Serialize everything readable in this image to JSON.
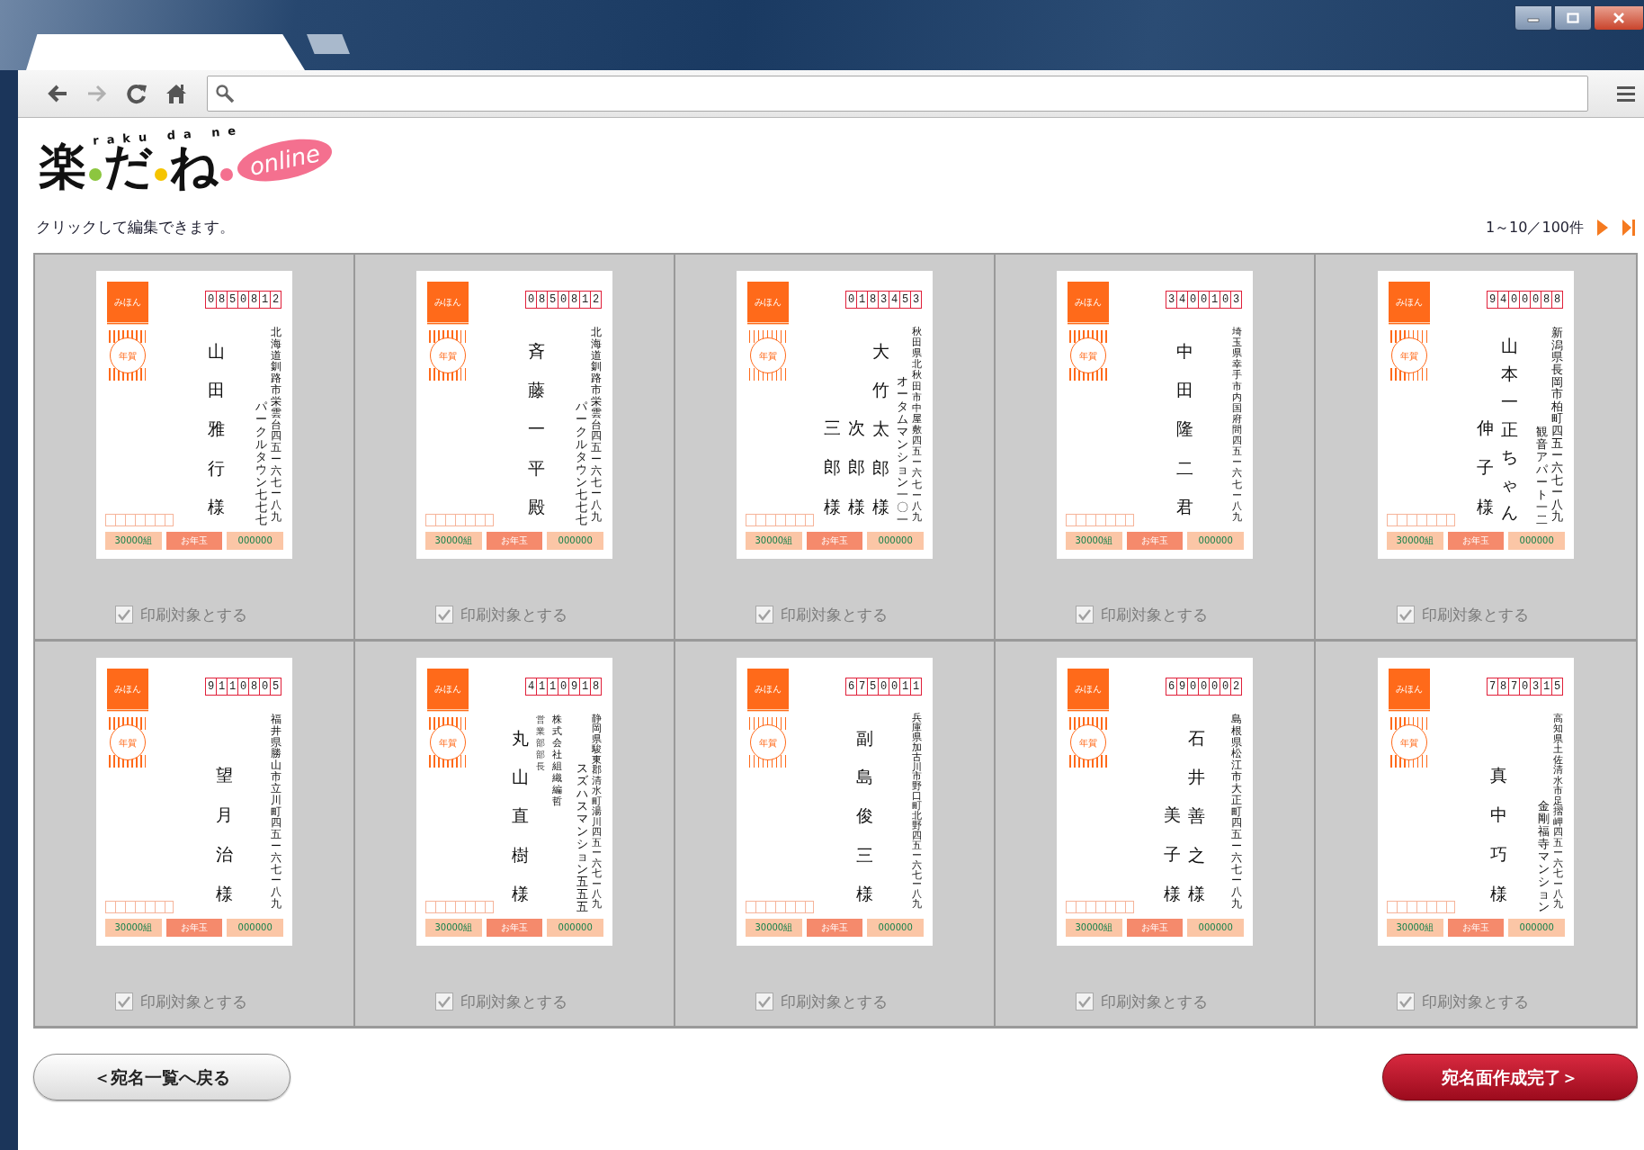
{
  "browser": {
    "tabs": [
      {
        "kind": "page",
        "selected": true
      },
      {
        "kind": "new",
        "selected": false
      }
    ]
  },
  "logo": {
    "chars": [
      "楽",
      "だ",
      "ね"
    ],
    "reading": "raku da ne",
    "badge": "online"
  },
  "instruction": "クリックして編集できます。",
  "pager": {
    "range": "1～10／100件"
  },
  "cards": [
    {
      "postal_code": "0850812",
      "stamp": "みほん",
      "postmark": "年賀",
      "address": [
        "パークルタウン七七七",
        "北海道釧路市栄雲台四五ー六七ー八九"
      ],
      "names": [
        {
          "kind": "name",
          "text": "山田雅行様"
        }
      ],
      "lottery": [
        "30000組",
        "お年玉",
        "000000"
      ],
      "print": {
        "label": "印刷対象とする",
        "checked": true,
        "disabled": true
      }
    },
    {
      "postal_code": "0850812",
      "stamp": "みほん",
      "postmark": "年賀",
      "address": [
        "パークルタウン七七七",
        "北海道釧路市栄雲台四五ー六七ー八九"
      ],
      "names": [
        {
          "kind": "name",
          "text": "斉藤一平殿"
        }
      ],
      "lottery": [
        "30000組",
        "お年玉",
        "000000"
      ],
      "print": {
        "label": "印刷対象とする",
        "checked": true,
        "disabled": true
      }
    },
    {
      "postal_code": "0183453",
      "stamp": "みほん",
      "postmark": "年賀",
      "address": [
        "オータムマンション一〇一",
        "秋田県北秋田市中屋敷四五ー六七ー八九"
      ],
      "names": [
        {
          "kind": "name",
          "text": "三郎様"
        },
        {
          "kind": "name",
          "text": "次郎様"
        },
        {
          "kind": "name",
          "text": "大竹太郎様"
        }
      ],
      "lottery": [
        "30000組",
        "お年玉",
        "000000"
      ],
      "print": {
        "label": "印刷対象とする",
        "checked": true,
        "disabled": true
      }
    },
    {
      "postal_code": "3400103",
      "stamp": "みほん",
      "postmark": "年賀",
      "address": [
        "埼玉県幸手市内国府間四五ー六七ー八九"
      ],
      "names": [
        {
          "kind": "name",
          "text": "中田隆二君"
        }
      ],
      "lottery": [
        "30000組",
        "お年玉",
        "000000"
      ],
      "print": {
        "label": "印刷対象とする",
        "checked": true,
        "disabled": true
      }
    },
    {
      "postal_code": "9400088",
      "stamp": "みほん",
      "postmark": "年賀",
      "address": [
        "観音アパート一二",
        "新潟県長岡市柏町四五ー六七ー八九"
      ],
      "names": [
        {
          "kind": "name",
          "text": "伸子様"
        },
        {
          "kind": "name",
          "text": "山本一正ちゃん"
        }
      ],
      "lottery": [
        "30000組",
        "お年玉",
        "000000"
      ],
      "print": {
        "label": "印刷対象とする",
        "checked": true,
        "disabled": true
      }
    },
    {
      "postal_code": "9110805",
      "stamp": "みほん",
      "postmark": "年賀",
      "address": [
        "福井県勝山市立川町四五ー六七ー八九"
      ],
      "names": [
        {
          "kind": "name",
          "text": "望月治様"
        }
      ],
      "lottery": [
        "30000組",
        "お年玉",
        "000000"
      ],
      "print": {
        "label": "印刷対象とする",
        "checked": true,
        "disabled": true
      }
    },
    {
      "postal_code": "4110918",
      "stamp": "みほん",
      "postmark": "年賀",
      "address": [
        "スズハスマンション五五五",
        "静岡県駿東郡清水町湯川四五ー六七ー八九"
      ],
      "names": [
        {
          "kind": "name",
          "text": "丸山直樹様"
        },
        {
          "kind": "title",
          "text": "営業部部長"
        },
        {
          "kind": "company",
          "text": "株式会社組織編哲"
        }
      ],
      "lottery": [
        "30000組",
        "お年玉",
        "000000"
      ],
      "print": {
        "label": "印刷対象とする",
        "checked": true,
        "disabled": true
      }
    },
    {
      "postal_code": "6750011",
      "stamp": "みほん",
      "postmark": "年賀",
      "address": [
        "兵庫県加古川市野口町北野四五ー六七ー八九"
      ],
      "names": [
        {
          "kind": "name",
          "text": "副島俊三様"
        }
      ],
      "lottery": [
        "30000組",
        "お年玉",
        "000000"
      ],
      "print": {
        "label": "印刷対象とする",
        "checked": true,
        "disabled": true
      }
    },
    {
      "postal_code": "6900002",
      "stamp": "みほん",
      "postmark": "年賀",
      "address": [
        "島根県松江市大正町四五ー六七ー八九"
      ],
      "names": [
        {
          "kind": "name",
          "text": "美子様"
        },
        {
          "kind": "name",
          "text": "石井善之様"
        }
      ],
      "lottery": [
        "30000組",
        "お年玉",
        "000000"
      ],
      "print": {
        "label": "印刷対象とする",
        "checked": true,
        "disabled": true
      }
    },
    {
      "postal_code": "7870315",
      "stamp": "みほん",
      "postmark": "年賀",
      "address": [
        "金剛福寺マンション",
        "高知県土佐清水市足摺岬四五ー六七ー八九"
      ],
      "names": [
        {
          "kind": "name",
          "text": "真中巧様"
        }
      ],
      "lottery": [
        "30000組",
        "お年玉",
        "000000"
      ],
      "print": {
        "label": "印刷対象とする",
        "checked": true,
        "disabled": true
      }
    }
  ],
  "footer": {
    "back": "＜宛名一覧へ戻る",
    "done": "宛名面作成完了＞"
  }
}
